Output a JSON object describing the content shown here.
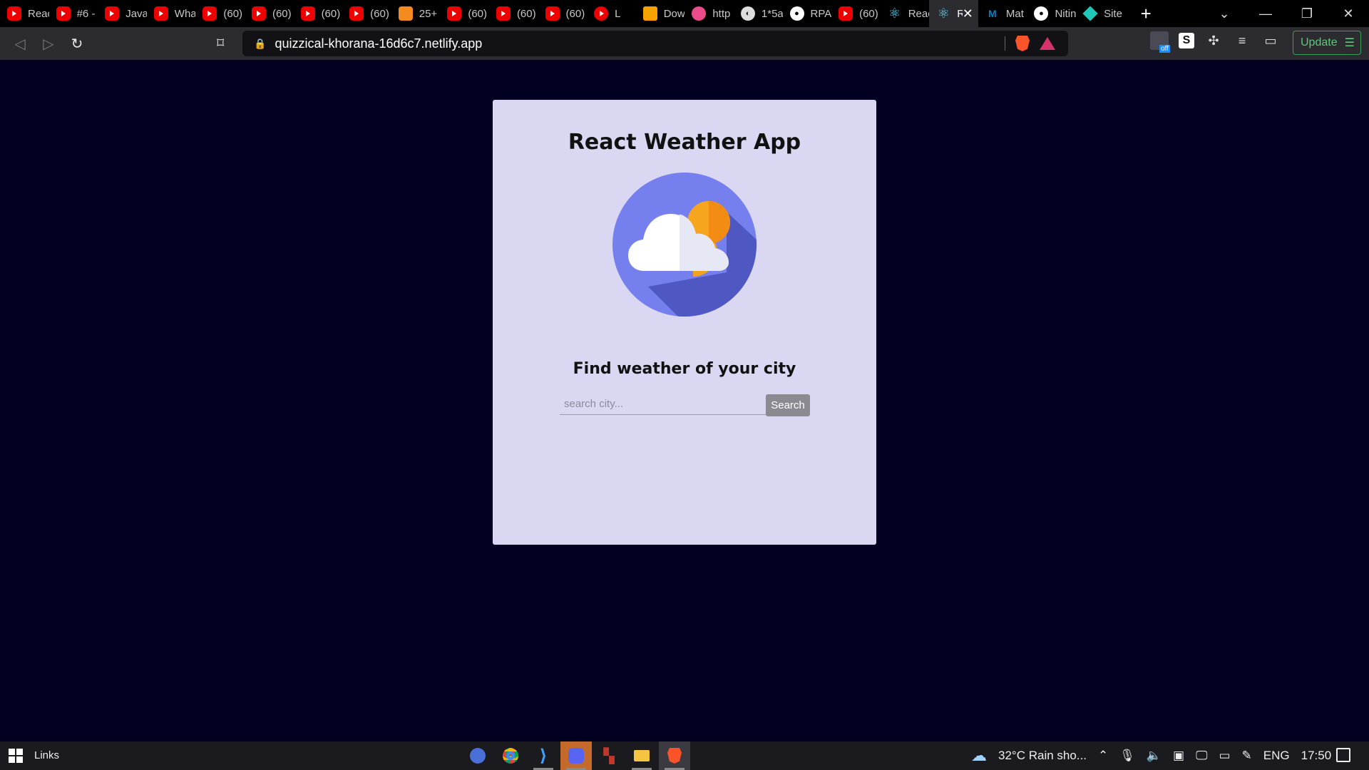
{
  "browser": {
    "tabs": [
      {
        "label": "React",
        "favicon": "youtube-icon"
      },
      {
        "label": "#6 -",
        "favicon": "youtube-icon"
      },
      {
        "label": "Javas",
        "favicon": "youtube-icon"
      },
      {
        "label": "What",
        "favicon": "youtube-icon"
      },
      {
        "label": "(60)",
        "favicon": "youtube-icon"
      },
      {
        "label": "(60)",
        "favicon": "youtube-icon"
      },
      {
        "label": "(60)",
        "favicon": "youtube-icon"
      },
      {
        "label": "(60)",
        "favicon": "youtube-icon"
      },
      {
        "label": "25+",
        "favicon": "orange-app-icon"
      },
      {
        "label": "(60)",
        "favicon": "youtube-icon"
      },
      {
        "label": "(60)",
        "favicon": "youtube-icon"
      },
      {
        "label": "(60)",
        "favicon": "youtube-icon"
      },
      {
        "label": "L",
        "favicon": "youtube-music-icon"
      },
      {
        "label": "Dow",
        "favicon": "yellow-app-icon"
      },
      {
        "label": "http",
        "favicon": "dribbble-icon"
      },
      {
        "label": "1*5a",
        "favicon": "globe-icon"
      },
      {
        "label": "RPA",
        "favicon": "github-icon"
      },
      {
        "label": "(60)",
        "favicon": "youtube-icon"
      },
      {
        "label": "Reac",
        "favicon": "react-icon"
      },
      {
        "label": "R",
        "favicon": "react-icon"
      },
      {
        "label": "Mat",
        "favicon": "mui-icon"
      },
      {
        "label": "Nitin",
        "favicon": "github-icon"
      },
      {
        "label": "Site",
        "favicon": "netlify-icon"
      }
    ],
    "active_tab_index": 19,
    "url": "quizzical-khorana-16d6c7.netlify.app",
    "update_label": "Update"
  },
  "app": {
    "title": "React Weather App",
    "heading": "Find weather of your city",
    "search_placeholder": "search city...",
    "search_button": "Search"
  },
  "taskbar": {
    "links_label": "Links",
    "weather": "32°C  Rain sho...",
    "language": "ENG",
    "time": "17:50"
  },
  "colors": {
    "page_background": "#010021",
    "card_background": "#d9d7f1",
    "icon_circle": "#7580ee"
  }
}
